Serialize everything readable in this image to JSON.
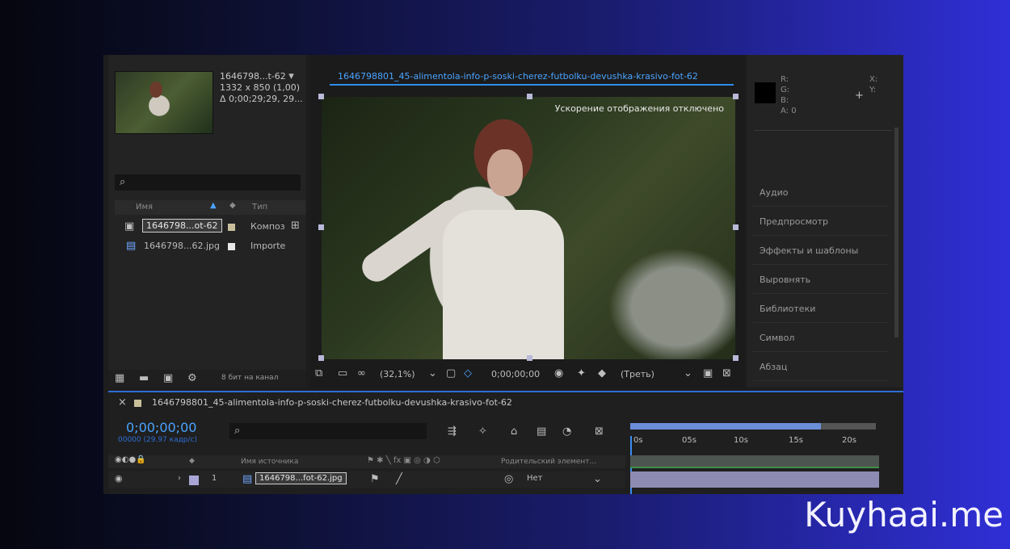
{
  "project": {
    "item_name": "1646798...t-62",
    "dimensions": "1332 x 850 (1,00)",
    "duration": "Δ 0;00;29;29, 29...",
    "search_icon": "search-icon",
    "columns": {
      "name": "Имя",
      "type": "Тип"
    },
    "items": [
      {
        "name": "1646798...ot-62",
        "type": "Композ"
      },
      {
        "name": "1646798...62.jpg",
        "type": "Importe"
      }
    ],
    "bit_depth": "8 бит на канал"
  },
  "composition": {
    "tab_title": "1646798801_45-alimentola-info-p-soski-cherez-futbolku-devushka-krasivo-fot-62",
    "overlay": "Ускорение отображения отключено",
    "zoom": "(32,1%)",
    "timecode": "0;00;00;00",
    "view": "(Треть)"
  },
  "info": {
    "labels": [
      "R:",
      "G:",
      "B:",
      "A: 0"
    ],
    "xy": [
      "X:",
      "Y:"
    ],
    "panels": [
      "Аудио",
      "Предпросмотр",
      "Эффекты и шаблоны",
      "Выровнять",
      "Библиотеки",
      "Символ",
      "Абзац"
    ]
  },
  "timeline": {
    "comp_name": "1646798801_45-alimentola-info-p-soski-cherez-futbolku-devushka-krasivo-fot-62",
    "timecode": "0;00;00;00",
    "fps": "00000 (29.97 кадр/с)",
    "ruler": [
      "0s",
      "05s",
      "10s",
      "15s",
      "20s"
    ],
    "layer_header": {
      "source": "Имя источника",
      "parent": "Родительский элемент..."
    },
    "layer": {
      "number": "1",
      "name": "1646798...fot-62.jpg",
      "parent": "Нет"
    }
  },
  "watermark": "Kuyhaai.me"
}
